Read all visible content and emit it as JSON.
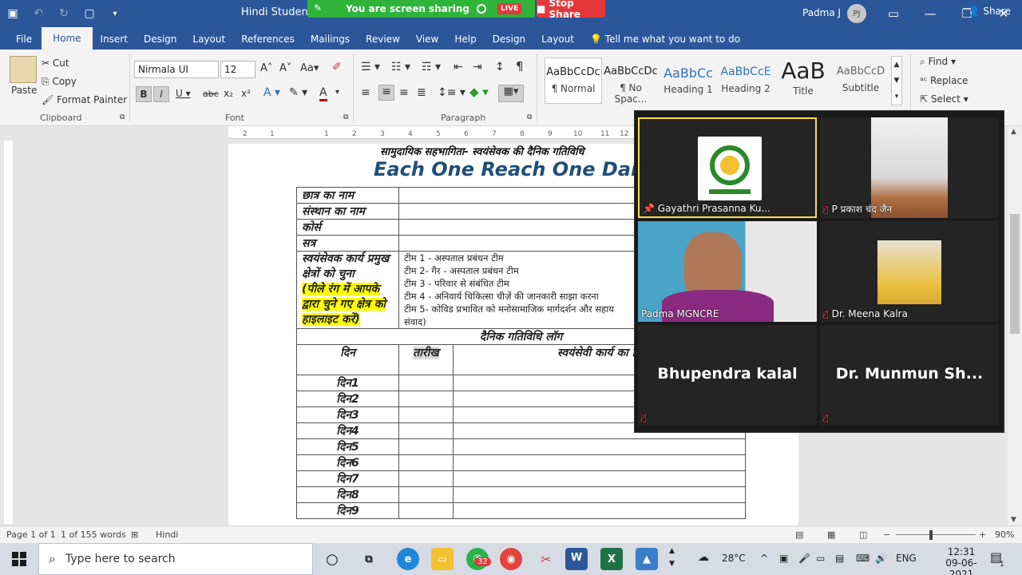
{
  "titlebar": {
    "doc_title": "Hindi Students D",
    "sharing_text": "You are screen sharing",
    "live_badge": "LIVE",
    "stop_share": "Stop Share",
    "user_name": "Padma J",
    "user_initials": "PJ"
  },
  "tabs": [
    "File",
    "Home",
    "Insert",
    "Design",
    "Layout",
    "References",
    "Mailings",
    "Review",
    "View",
    "Help",
    "Design",
    "Layout"
  ],
  "tell_me": "Tell me what you want to do",
  "share_label": "Share",
  "ribbon": {
    "clipboard": {
      "paste": "Paste",
      "cut": "Cut",
      "copy": "Copy",
      "format_painter": "Format Painter",
      "label": "Clipboard"
    },
    "font": {
      "name": "Nirmala UI",
      "size": "12",
      "label": "Font"
    },
    "paragraph": {
      "label": "Paragraph"
    },
    "styles": [
      {
        "sample": "AaBbCcDc",
        "name": "¶ Normal"
      },
      {
        "sample": "AaBbCcDc",
        "name": "¶ No Spac..."
      },
      {
        "sample": "AaBbCc",
        "name": "Heading 1"
      },
      {
        "sample": "AaBbCcE",
        "name": "Heading 2"
      },
      {
        "sample": "AaB",
        "name": "Title"
      },
      {
        "sample": "AaBbCcD",
        "name": "Subtitle"
      }
    ],
    "editing": {
      "find": "Find",
      "replace": "Replace",
      "select": "Select"
    }
  },
  "document": {
    "heading1": "सामुदायिक सहभागिता- स्वयंसेवक की दैनिक गतिविधि",
    "heading2": "Each One Reach One Daily",
    "rows": {
      "student_name": "छात्र का नाम",
      "institute_name": "संस्थान का नाम",
      "course": "कोर्स",
      "session": "सत्र",
      "volunteer_label": "स्वयंसेवक कार्य प्रमुख क्षेत्रों को चुना",
      "highlight_note": "(पीले रंग में आपके द्वारा चुने गए क्षेत्र को हाइलाइट करें)"
    },
    "teams": [
      "टीम 1 - अस्पताल प्रबंधन टीम",
      "टीम 2- गैर - अस्पताल प्रबंधन टीम",
      "टीम 3 - परिवार से संबंधित टीम",
      "टीम 4 - अनिवार्य चिकित्सा चीज़ें की जानकारी साझा करना",
      "टीम 5- कोविड प्रभावित को मनोसामाजिक मार्गदर्शन और सहाय",
      "संवाद)"
    ],
    "log_title": "दैनिक गतिविधि लॉग",
    "col_day": "दिन",
    "col_date": "तारीख",
    "col_work": "स्वयंसेवी कार्य का वि",
    "days": [
      "दिन1",
      "दिन2",
      "दिन3",
      "दिन4",
      "दिन5",
      "दिन6",
      "दिन7",
      "दिन8",
      "दिन9"
    ]
  },
  "zoom": {
    "participants": [
      "Gayathri Prasanna Ku...",
      "P प्रकाश चंद जैन",
      "Padma MGNCRE",
      "Dr. Meena Kalra",
      "Bhupendra kalal",
      "Dr. Munmun Sh..."
    ]
  },
  "status": {
    "page": "Page 1 of 1",
    "words": "1 of 155 words",
    "language": "Hindi",
    "zoom": "90%"
  },
  "taskbar": {
    "search_placeholder": "Type here to search",
    "whatsapp_badge": "32",
    "weather": "28°C",
    "lang": "ENG",
    "time": "12:31",
    "date": "09-06-2021",
    "notif": "1"
  }
}
